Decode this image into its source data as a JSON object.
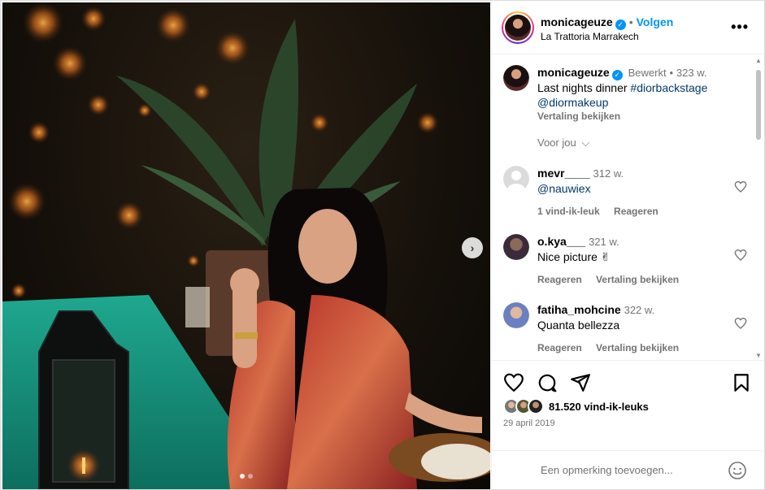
{
  "post": {
    "username": "monicageuze",
    "follow_label": "Volgen",
    "separator": "•",
    "location": "La Trattoria Marrakech",
    "more_label": "•••"
  },
  "caption": {
    "username": "monicageuze",
    "edited": "Bewerkt",
    "dot": "•",
    "time": "323 w.",
    "text": "Last nights dinner",
    "hashtag": "#diorbackstage",
    "mention": "@diormakeup",
    "translation": "Vertaling bekijken",
    "voor_jou": "Voor jou"
  },
  "comments": [
    {
      "username": "mevr____",
      "time": "312 w.",
      "text": "@nauwiex",
      "likes": "1 vind-ik-leuk",
      "reply": "Reageren",
      "translate": ""
    },
    {
      "username": "o.kya___",
      "time": "321 w.",
      "text": "Nice picture ✌",
      "likes": "",
      "reply": "Reageren",
      "translate": "Vertaling bekijken"
    },
    {
      "username": "fatiha_mohcine",
      "time": "322 w.",
      "text": "Quanta bellezza",
      "likes": "",
      "reply": "Reageren",
      "translate": "Vertaling bekijken"
    }
  ],
  "actions": {
    "likes_count": "81.520 vind-ik-leuks",
    "date": "29 april 2019",
    "comment_placeholder": "Een opmerking toevoegen..."
  },
  "icons": {
    "heart": "heart-icon",
    "comment": "comment-icon",
    "share": "share-icon",
    "save": "bookmark-icon",
    "emoji": "smiley-icon",
    "verified": "verified-icon",
    "next": "chevron-right-icon"
  },
  "colors": {
    "accent": "#0095f6",
    "muted": "#737373",
    "link": "#00376b",
    "border": "#efefef"
  }
}
